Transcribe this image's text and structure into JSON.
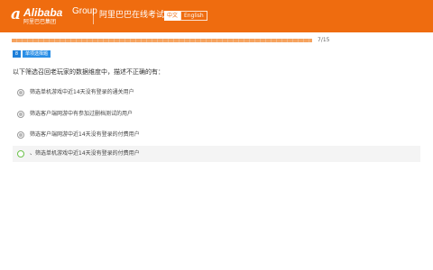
{
  "header": {
    "brand_mark": "a",
    "brand_word": "Alibaba",
    "brand_group": "Group",
    "brand_cn": "阿里巴巴集团",
    "app_title": "阿里巴巴在线考试",
    "lang_zh": "中文",
    "lang_en": "English",
    "background_color": "#ef6c0f"
  },
  "progress": {
    "counter": "7/15",
    "current": 7,
    "total": 15,
    "color": "#f6a35f"
  },
  "question": {
    "number": "8",
    "type_label": "单项选择题",
    "prompt": "以下筛选召回老玩家的数据维度中，描述不正确的有："
  },
  "options": [
    {
      "label": "筛选单机游戏中近14天没有登录的通关用户",
      "selected": false
    },
    {
      "label": "筛选客户端网游中有参加过删档测试的用户",
      "selected": false
    },
    {
      "label": "筛选客户端网游中近14天没有登录的付费用户",
      "selected": false
    },
    {
      "label": "、筛选单机游戏中近14天没有登录的付费用户",
      "selected": true
    }
  ]
}
